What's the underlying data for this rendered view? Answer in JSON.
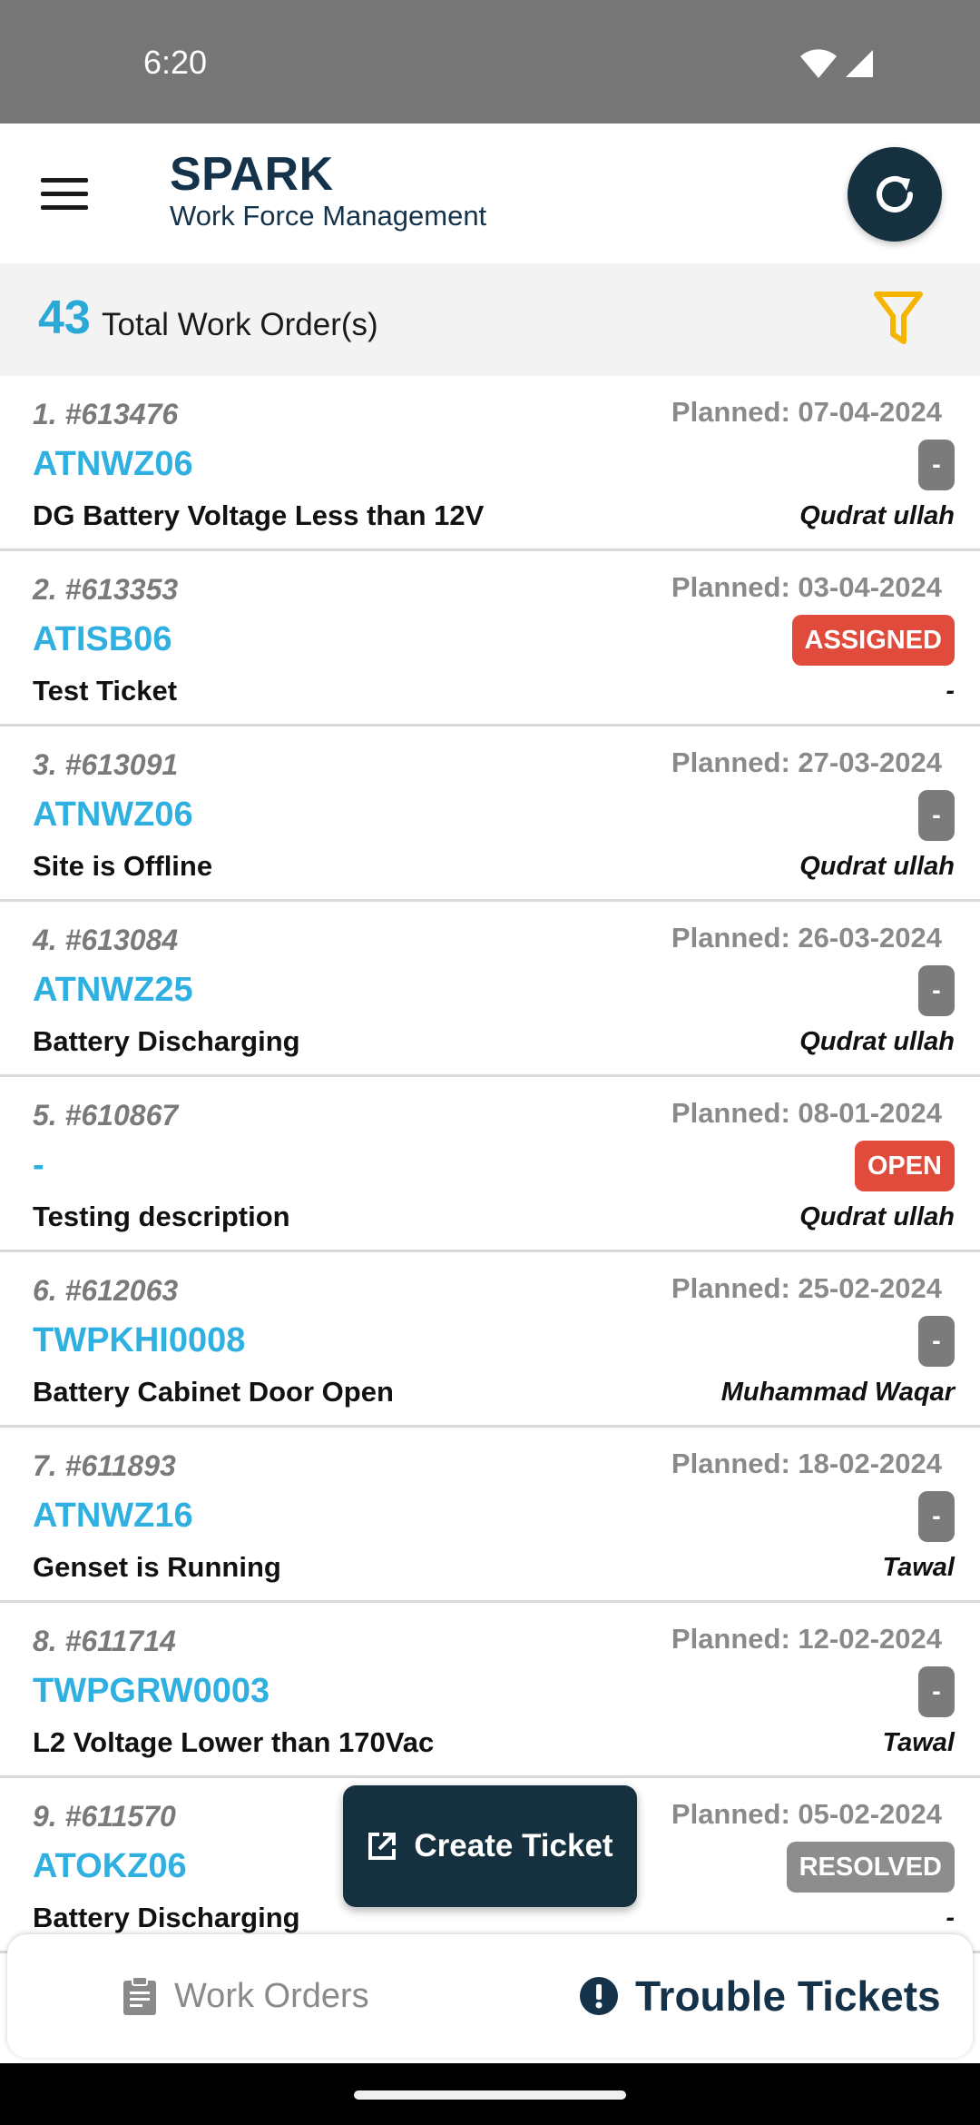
{
  "status_bar": {
    "time": "6:20"
  },
  "header": {
    "title": "SPARK",
    "subtitle": "Work Force Management"
  },
  "summary": {
    "count": "43",
    "label": "Total Work Order(s)"
  },
  "work_orders": [
    {
      "num": "1. #613476",
      "planned": "Planned: 07-04-2024",
      "site": "ATNWZ06",
      "status": "-",
      "desc": "DG Battery Voltage Less than 12V",
      "assignee": "Qudrat ullah"
    },
    {
      "num": "2. #613353",
      "planned": "Planned: 03-04-2024",
      "site": "ATISB06",
      "status": "ASSIGNED",
      "desc": "Test Ticket",
      "assignee": "-"
    },
    {
      "num": "3. #613091",
      "planned": "Planned: 27-03-2024",
      "site": "ATNWZ06",
      "status": "-",
      "desc": "Site is Offline",
      "assignee": "Qudrat ullah"
    },
    {
      "num": "4. #613084",
      "planned": "Planned: 26-03-2024",
      "site": "ATNWZ25",
      "status": "-",
      "desc": "Battery Discharging",
      "assignee": "Qudrat ullah"
    },
    {
      "num": "5. #610867",
      "planned": "Planned: 08-01-2024",
      "site": "-",
      "status": "OPEN",
      "desc": "Testing description",
      "assignee": "Qudrat ullah"
    },
    {
      "num": "6. #612063",
      "planned": "Planned: 25-02-2024",
      "site": "TWPKHI0008",
      "status": "-",
      "desc": "Battery Cabinet Door Open",
      "assignee": "Muhammad Waqar"
    },
    {
      "num": "7. #611893",
      "planned": "Planned: 18-02-2024",
      "site": "ATNWZ16",
      "status": "-",
      "desc": "Genset is Running",
      "assignee": "Tawal"
    },
    {
      "num": "8. #611714",
      "planned": "Planned: 12-02-2024",
      "site": "TWPGRW0003",
      "status": "-",
      "desc": "L2 Voltage Lower than 170Vac",
      "assignee": "Tawal"
    },
    {
      "num": "9. #611570",
      "planned": "Planned: 05-02-2024",
      "site": "ATOKZ06",
      "status": "RESOLVED",
      "desc": "Battery Discharging",
      "assignee": "-"
    }
  ],
  "fab": {
    "label": "Create Ticket"
  },
  "bottom_nav": {
    "work_orders": "Work Orders",
    "trouble_tickets": "Trouble Tickets"
  },
  "colors": {
    "accent": "#2fb0e0",
    "primary": "#15303f",
    "badge_red": "#e14b3b",
    "badge_grey": "#7b7b7b",
    "filter": "#f5b400"
  }
}
